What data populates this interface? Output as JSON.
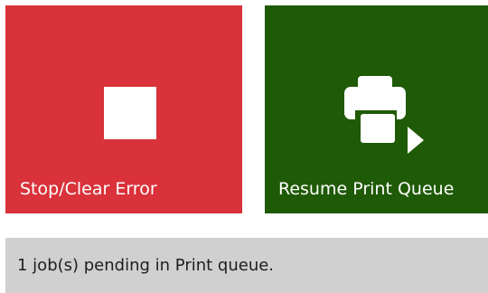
{
  "tiles": {
    "stop": {
      "label": "Stop/Clear Error",
      "color": "#d9323a",
      "icon": "stop-square-icon"
    },
    "resume": {
      "label": "Resume Print Queue",
      "color": "#1f5a06",
      "icon": "printer-play-icon"
    }
  },
  "status": {
    "text": "1 job(s) pending in Print queue."
  }
}
